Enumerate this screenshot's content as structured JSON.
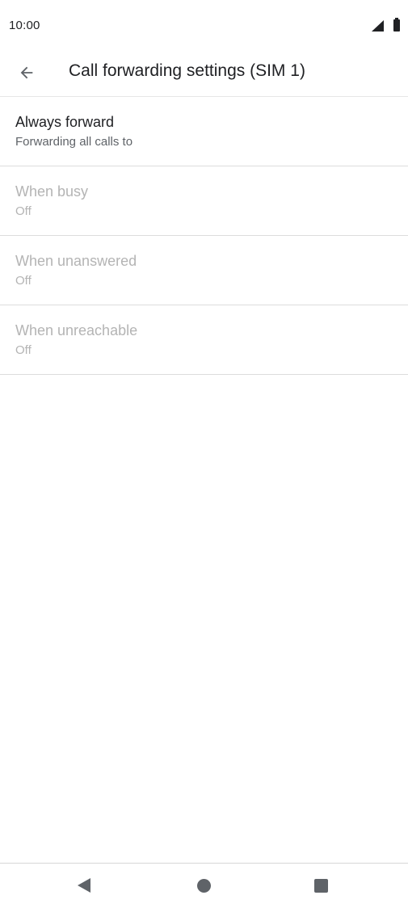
{
  "status_bar": {
    "time": "10:00",
    "icons": [
      "signal-icon",
      "battery-icon"
    ]
  },
  "app_bar": {
    "back_icon": "arrow-back-icon",
    "title": "Call forwarding settings (SIM 1)"
  },
  "settings": {
    "items": [
      {
        "title": "Always forward",
        "summary": "Forwarding all calls to",
        "enabled": true
      },
      {
        "title": "When busy",
        "summary": "Off",
        "enabled": false
      },
      {
        "title": "When unanswered",
        "summary": "Off",
        "enabled": false
      },
      {
        "title": "When unreachable",
        "summary": "Off",
        "enabled": false
      }
    ]
  },
  "nav_bar": {
    "icons": [
      "nav-back-icon",
      "nav-home-icon",
      "nav-recents-icon"
    ]
  },
  "colors": {
    "text_primary": "#202124",
    "text_secondary": "#5f6368",
    "text_disabled": "#b4b4b4",
    "divider": "#dcdcdc"
  }
}
